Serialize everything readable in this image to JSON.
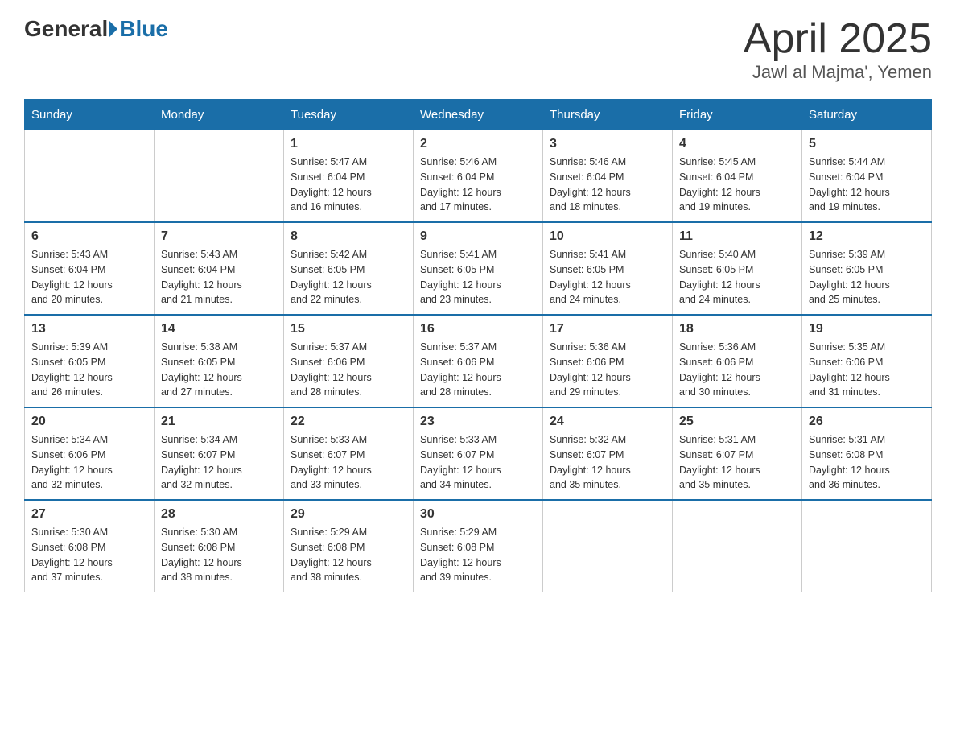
{
  "header": {
    "logo_general": "General",
    "logo_blue": "Blue",
    "title": "April 2025",
    "subtitle": "Jawl al Majma', Yemen"
  },
  "days_of_week": [
    "Sunday",
    "Monday",
    "Tuesday",
    "Wednesday",
    "Thursday",
    "Friday",
    "Saturday"
  ],
  "weeks": [
    [
      {
        "day": "",
        "info": ""
      },
      {
        "day": "",
        "info": ""
      },
      {
        "day": "1",
        "info": "Sunrise: 5:47 AM\nSunset: 6:04 PM\nDaylight: 12 hours\nand 16 minutes."
      },
      {
        "day": "2",
        "info": "Sunrise: 5:46 AM\nSunset: 6:04 PM\nDaylight: 12 hours\nand 17 minutes."
      },
      {
        "day": "3",
        "info": "Sunrise: 5:46 AM\nSunset: 6:04 PM\nDaylight: 12 hours\nand 18 minutes."
      },
      {
        "day": "4",
        "info": "Sunrise: 5:45 AM\nSunset: 6:04 PM\nDaylight: 12 hours\nand 19 minutes."
      },
      {
        "day": "5",
        "info": "Sunrise: 5:44 AM\nSunset: 6:04 PM\nDaylight: 12 hours\nand 19 minutes."
      }
    ],
    [
      {
        "day": "6",
        "info": "Sunrise: 5:43 AM\nSunset: 6:04 PM\nDaylight: 12 hours\nand 20 minutes."
      },
      {
        "day": "7",
        "info": "Sunrise: 5:43 AM\nSunset: 6:04 PM\nDaylight: 12 hours\nand 21 minutes."
      },
      {
        "day": "8",
        "info": "Sunrise: 5:42 AM\nSunset: 6:05 PM\nDaylight: 12 hours\nand 22 minutes."
      },
      {
        "day": "9",
        "info": "Sunrise: 5:41 AM\nSunset: 6:05 PM\nDaylight: 12 hours\nand 23 minutes."
      },
      {
        "day": "10",
        "info": "Sunrise: 5:41 AM\nSunset: 6:05 PM\nDaylight: 12 hours\nand 24 minutes."
      },
      {
        "day": "11",
        "info": "Sunrise: 5:40 AM\nSunset: 6:05 PM\nDaylight: 12 hours\nand 24 minutes."
      },
      {
        "day": "12",
        "info": "Sunrise: 5:39 AM\nSunset: 6:05 PM\nDaylight: 12 hours\nand 25 minutes."
      }
    ],
    [
      {
        "day": "13",
        "info": "Sunrise: 5:39 AM\nSunset: 6:05 PM\nDaylight: 12 hours\nand 26 minutes."
      },
      {
        "day": "14",
        "info": "Sunrise: 5:38 AM\nSunset: 6:05 PM\nDaylight: 12 hours\nand 27 minutes."
      },
      {
        "day": "15",
        "info": "Sunrise: 5:37 AM\nSunset: 6:06 PM\nDaylight: 12 hours\nand 28 minutes."
      },
      {
        "day": "16",
        "info": "Sunrise: 5:37 AM\nSunset: 6:06 PM\nDaylight: 12 hours\nand 28 minutes."
      },
      {
        "day": "17",
        "info": "Sunrise: 5:36 AM\nSunset: 6:06 PM\nDaylight: 12 hours\nand 29 minutes."
      },
      {
        "day": "18",
        "info": "Sunrise: 5:36 AM\nSunset: 6:06 PM\nDaylight: 12 hours\nand 30 minutes."
      },
      {
        "day": "19",
        "info": "Sunrise: 5:35 AM\nSunset: 6:06 PM\nDaylight: 12 hours\nand 31 minutes."
      }
    ],
    [
      {
        "day": "20",
        "info": "Sunrise: 5:34 AM\nSunset: 6:06 PM\nDaylight: 12 hours\nand 32 minutes."
      },
      {
        "day": "21",
        "info": "Sunrise: 5:34 AM\nSunset: 6:07 PM\nDaylight: 12 hours\nand 32 minutes."
      },
      {
        "day": "22",
        "info": "Sunrise: 5:33 AM\nSunset: 6:07 PM\nDaylight: 12 hours\nand 33 minutes."
      },
      {
        "day": "23",
        "info": "Sunrise: 5:33 AM\nSunset: 6:07 PM\nDaylight: 12 hours\nand 34 minutes."
      },
      {
        "day": "24",
        "info": "Sunrise: 5:32 AM\nSunset: 6:07 PM\nDaylight: 12 hours\nand 35 minutes."
      },
      {
        "day": "25",
        "info": "Sunrise: 5:31 AM\nSunset: 6:07 PM\nDaylight: 12 hours\nand 35 minutes."
      },
      {
        "day": "26",
        "info": "Sunrise: 5:31 AM\nSunset: 6:08 PM\nDaylight: 12 hours\nand 36 minutes."
      }
    ],
    [
      {
        "day": "27",
        "info": "Sunrise: 5:30 AM\nSunset: 6:08 PM\nDaylight: 12 hours\nand 37 minutes."
      },
      {
        "day": "28",
        "info": "Sunrise: 5:30 AM\nSunset: 6:08 PM\nDaylight: 12 hours\nand 38 minutes."
      },
      {
        "day": "29",
        "info": "Sunrise: 5:29 AM\nSunset: 6:08 PM\nDaylight: 12 hours\nand 38 minutes."
      },
      {
        "day": "30",
        "info": "Sunrise: 5:29 AM\nSunset: 6:08 PM\nDaylight: 12 hours\nand 39 minutes."
      },
      {
        "day": "",
        "info": ""
      },
      {
        "day": "",
        "info": ""
      },
      {
        "day": "",
        "info": ""
      }
    ]
  ]
}
